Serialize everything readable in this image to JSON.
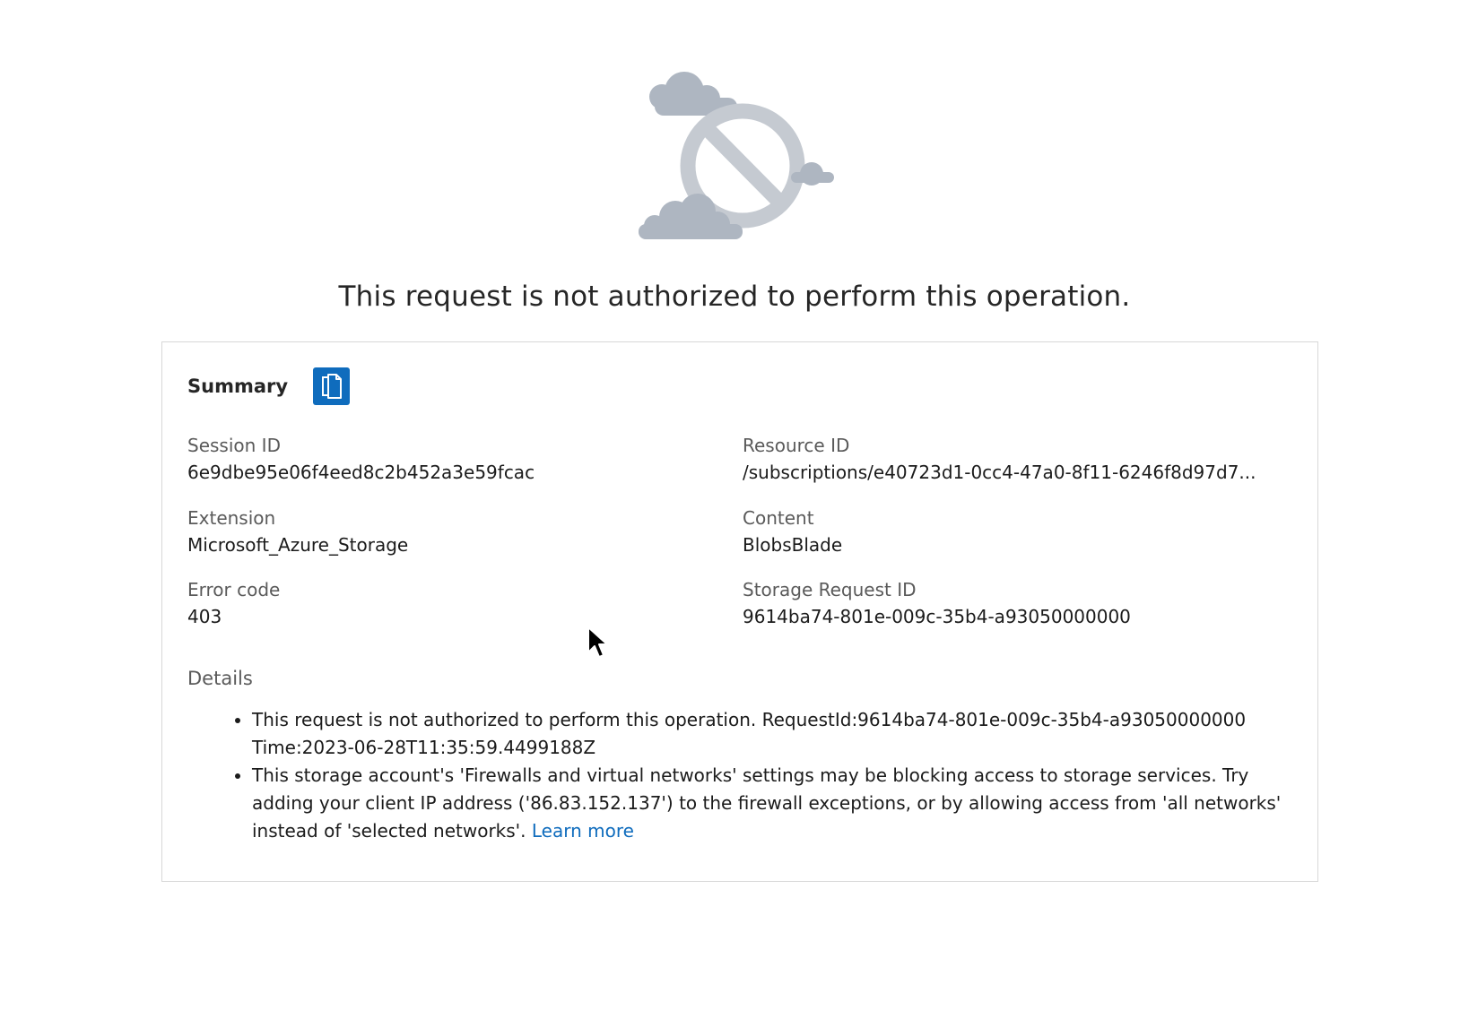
{
  "error": {
    "title": "This request is not authorized to perform this operation."
  },
  "summary": {
    "heading": "Summary",
    "fields": {
      "session_id": {
        "label": "Session ID",
        "value": "6e9dbe95e06f4eed8c2b452a3e59fcac"
      },
      "resource_id": {
        "label": "Resource ID",
        "value": "/subscriptions/e40723d1-0cc4-47a0-8f11-6246f8d97d7..."
      },
      "extension": {
        "label": "Extension",
        "value": "Microsoft_Azure_Storage"
      },
      "content": {
        "label": "Content",
        "value": "BlobsBlade"
      },
      "error_code": {
        "label": "Error code",
        "value": "403"
      },
      "storage_request_id": {
        "label": "Storage Request ID",
        "value": "9614ba74-801e-009c-35b4-a93050000000"
      }
    },
    "details": {
      "label": "Details",
      "item1_line1": "This request is not authorized to perform this operation. RequestId:9614ba74-801e-009c-35b4-a93050000000",
      "item1_line2": "Time:2023-06-28T11:35:59.4499188Z",
      "item2_text": "This storage account's 'Firewalls and virtual networks' settings may be blocking access to storage services. Try adding your client IP address ('86.83.152.137') to the firewall exceptions, or by allowing access from 'all networks' instead of 'selected networks'. ",
      "learn_more": "Learn more"
    }
  },
  "icons": {
    "hero": "blocked-cloud-icon",
    "copy": "copy-icon",
    "cursor": "mouse-pointer-icon"
  },
  "colors": {
    "accent": "#0f6cbd",
    "icon_gray": "#aeb6c1",
    "circle_gray": "#c5cad1"
  }
}
